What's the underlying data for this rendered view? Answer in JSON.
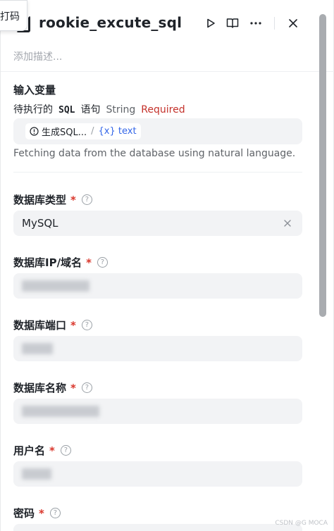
{
  "float_tag": {
    "label": "打码"
  },
  "header": {
    "title": "rookie_excute_sql",
    "description_placeholder": "添加描述..."
  },
  "input_section": {
    "title": "输入变量",
    "variable": {
      "desc": "待执行的",
      "name": "SQL",
      "suffix": "语句",
      "type": "String",
      "required": "Required"
    },
    "reference": {
      "source": "生成SQL...",
      "separator": "/",
      "var": "{x} text"
    },
    "hint": "Fetching data from the database using natural language."
  },
  "fields": [
    {
      "label": "数据库类型",
      "value": "MySQL"
    },
    {
      "label": "数据库IP/域名",
      "value": ""
    },
    {
      "label": "数据库端口",
      "value": ""
    },
    {
      "label": "数据库名称",
      "value": ""
    },
    {
      "label": "用户名",
      "value": ""
    },
    {
      "label": "密码",
      "value": ""
    }
  ],
  "star": "*",
  "help": "?",
  "watermark": "CSDN @G MOCA",
  "colors": {
    "required": "#c4322b",
    "var_link": "#3366e8",
    "input_bg": "#f2f3f5"
  }
}
